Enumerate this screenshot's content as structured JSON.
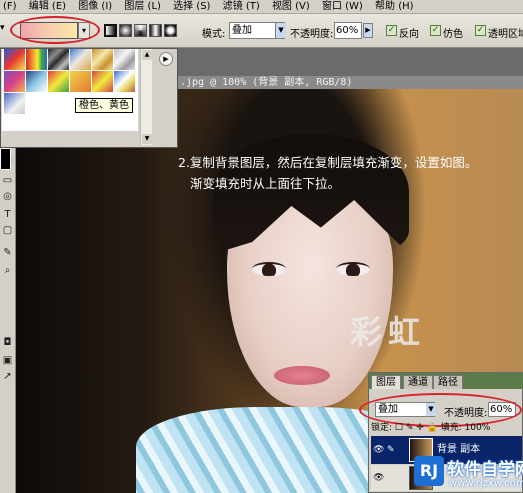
{
  "menubar": {
    "items": [
      "(F)",
      "编辑 (E)",
      "图像 (I)",
      "图层 (L)",
      "选择 (S)",
      "滤镜 (T)",
      "视图 (V)",
      "窗口 (W)",
      "帮助 (H)"
    ]
  },
  "options": {
    "mode_label": "模式:",
    "mode_value": "叠加",
    "opacity_label": "不透明度:",
    "opacity_value": "60%",
    "reverse_label": "反向",
    "dither_label": "仿色",
    "transparency_label": "透明区域",
    "gradient_colors": [
      "#f2a3a9",
      "#f7c9b0",
      "#fbe9a6"
    ]
  },
  "gradient_picker": {
    "tooltip": "橙色、黄色",
    "menu_glyph": "▶"
  },
  "document": {
    "title": ".jpg @ 100% (背景 副本, RGB/8)",
    "instruction_line1": "2.复制背景图层，然后在复制层填充渐变，设置如图。",
    "instruction_line2": "渐变填充时从上面往下拉。",
    "photo_watermark": "彩虹"
  },
  "layers_panel": {
    "tabs": [
      "图层",
      "通道",
      "路径"
    ],
    "blend_mode": "叠加",
    "opacity_label": "不透明度:",
    "opacity_value": "60%",
    "lock_row": "锁定: ☐ ✎ ✛ 🔒   填充: 100%",
    "layer_name": "背景 副本"
  },
  "site_watermark": {
    "badge": "RJ",
    "name": "软件自学网",
    "url": "www.rjzxw.com"
  }
}
